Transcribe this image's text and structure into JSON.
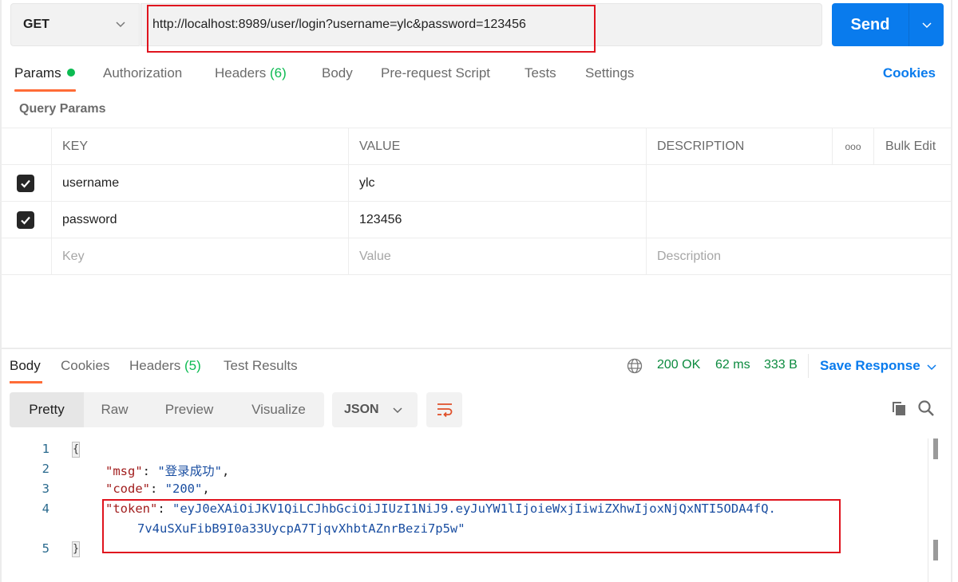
{
  "request": {
    "method": "GET",
    "url": "http://localhost:8989/user/login?username=ylc&password=123456",
    "send_label": "Send"
  },
  "request_tabs": [
    {
      "label": "Params",
      "active": true,
      "indicator": "green-dot"
    },
    {
      "label": "Authorization"
    },
    {
      "label": "Headers",
      "count": "(6)"
    },
    {
      "label": "Body"
    },
    {
      "label": "Pre-request Script"
    },
    {
      "label": "Tests"
    },
    {
      "label": "Settings"
    }
  ],
  "cookies_link": "Cookies",
  "query_params": {
    "title": "Query Params",
    "columns": {
      "key": "KEY",
      "value": "VALUE",
      "description": "DESCRIPTION",
      "more": "ooo",
      "bulk_edit": "Bulk Edit"
    },
    "rows": [
      {
        "checked": true,
        "key": "username",
        "value": "ylc",
        "description": ""
      },
      {
        "checked": true,
        "key": "password",
        "value": "123456",
        "description": ""
      }
    ],
    "placeholders": {
      "key": "Key",
      "value": "Value",
      "description": "Description"
    }
  },
  "response_tabs": [
    {
      "label": "Body",
      "active": true
    },
    {
      "label": "Cookies"
    },
    {
      "label": "Headers",
      "count": "(5)"
    },
    {
      "label": "Test Results"
    }
  ],
  "response_status": {
    "icon": "globe-icon",
    "status": "200 OK",
    "time": "62 ms",
    "size": "333 B",
    "save_label": "Save Response"
  },
  "view_modes": [
    "Pretty",
    "Raw",
    "Preview",
    "Visualize"
  ],
  "active_view": "Pretty",
  "format": "JSON",
  "icons": {
    "wrap": "wrap-lines-icon",
    "copy": "copy-icon",
    "search": "search-icon"
  },
  "body": {
    "line_numbers": [
      "1",
      "2",
      "3",
      "4",
      "5"
    ],
    "open_brace": "{",
    "close_brace": "}",
    "msg_key": "\"msg\"",
    "msg_value": "\"登录成功\"",
    "code_key": "\"code\"",
    "code_value": "\"200\"",
    "token_key": "\"token\"",
    "token_value_line1": "\"eyJ0eXAiOiJKV1QiLCJhbGciOiJIUzI1NiJ9.eyJuYW1lIjoieWxjIiwiZXhwIjoxNjQxNTI5ODA4fQ.",
    "token_value_line2": "7v4uSXuFibB9I0a33UycpA7TjqvXhbtAZnrBezi7p5w\"",
    "colon": ": ",
    "comma": ","
  },
  "colors": {
    "accent_blue": "#097bed",
    "tab_underline": "#ff6c37",
    "status_green": "#0b8a3e",
    "count_green": "#0cbb52",
    "highlight_red": "#e0141e"
  }
}
